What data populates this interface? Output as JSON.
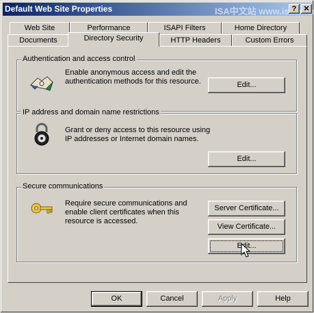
{
  "window": {
    "title": "Default Web Site Properties",
    "watermark": "ISA中文站  www.isacn.org"
  },
  "tabs_back": [
    "Web Site",
    "Performance",
    "ISAPI Filters",
    "Home Directory"
  ],
  "tabs_front": [
    "Documents",
    "Directory Security",
    "HTTP Headers",
    "Custom Errors"
  ],
  "active_tab": "Directory Security",
  "sections": {
    "auth": {
      "label": "Authentication and access control",
      "line1": "Enable anonymous access and edit the",
      "line2": "authentication methods for this resource.",
      "edit": "Edit..."
    },
    "ip": {
      "label": "IP address and domain name restrictions",
      "line1": "Grant or deny access to this resource using",
      "line2": "IP addresses or Internet domain names.",
      "edit": "Edit..."
    },
    "secure": {
      "label": "Secure communications",
      "line1": "Require secure communications and",
      "line2": "enable client certificates when this",
      "line3": "resource is accessed.",
      "server_cert": "Server Certificate...",
      "view_cert": "View Certificate...",
      "edit": "Edit..."
    }
  },
  "footer": {
    "ok": "OK",
    "cancel": "Cancel",
    "apply": "Apply",
    "help": "Help"
  },
  "colors": {
    "titlebar_start": "#0a246a",
    "titlebar_end": "#a6caf0",
    "face": "#d4d0c8"
  }
}
